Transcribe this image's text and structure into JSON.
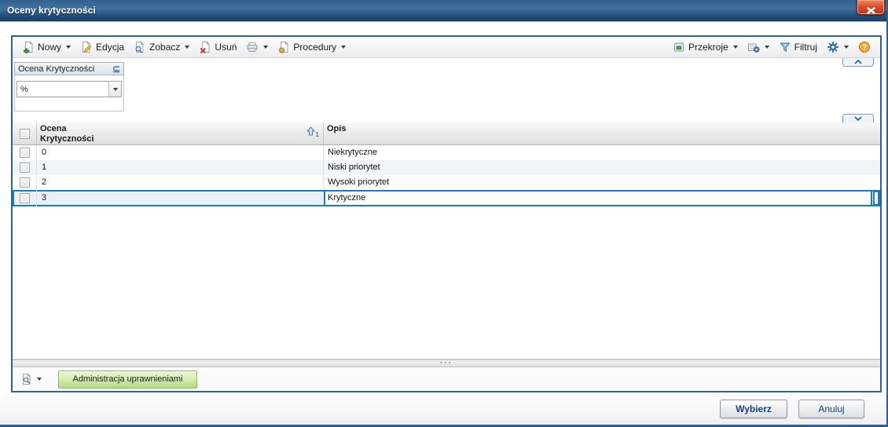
{
  "window": {
    "title": "Oceny krytyczności"
  },
  "toolbar": {
    "new_label": "Nowy",
    "edit_label": "Edycja",
    "view_label": "Zobacz",
    "delete_label": "Usuń",
    "procedures_label": "Procedury",
    "sections_label": "Przekroje",
    "filter_label": "Filtruj",
    "help_label": "?"
  },
  "filter_panel": {
    "title": "Ocena Krytyczności",
    "operator": "⊆",
    "value": "%"
  },
  "grid": {
    "columns": {
      "ocena": "Ocena Krytyczności",
      "opis": "Opis"
    },
    "sort_indicator": "1",
    "rows": [
      {
        "ocena": "0",
        "opis": "Niekrytyczne"
      },
      {
        "ocena": "1",
        "opis": "Niski priorytet"
      },
      {
        "ocena": "2",
        "opis": "Wysoki priorytet"
      },
      {
        "ocena": "3",
        "opis": "Krytyczne"
      }
    ],
    "splitter_dots": "···"
  },
  "bottom": {
    "tab_label": "Administracja uprawnieniami"
  },
  "footer": {
    "select_label": "Wybierz",
    "cancel_label": "Anuluj"
  },
  "colors": {
    "accent_blue": "#1b79c8",
    "title_bar": "#2f5d8c",
    "panel_border": "#2e6191",
    "tab_green": "#b3d981",
    "close_red": "#d94f2d",
    "help_orange": "#f3a73a"
  }
}
